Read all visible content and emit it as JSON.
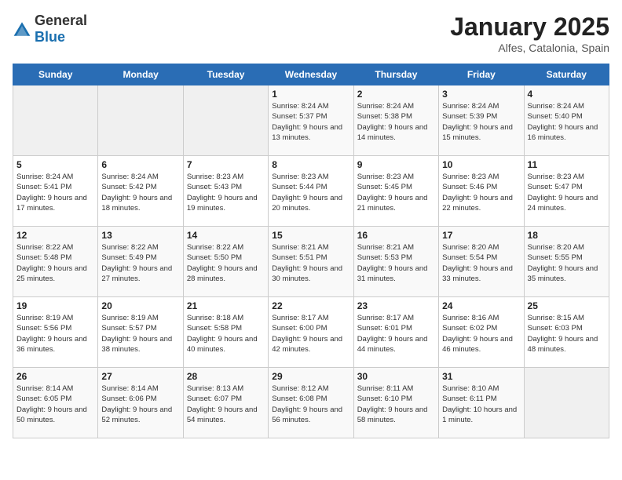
{
  "header": {
    "logo_general": "General",
    "logo_blue": "Blue",
    "title": "January 2025",
    "subtitle": "Alfes, Catalonia, Spain"
  },
  "days_of_week": [
    "Sunday",
    "Monday",
    "Tuesday",
    "Wednesday",
    "Thursday",
    "Friday",
    "Saturday"
  ],
  "weeks": [
    [
      {
        "day": null
      },
      {
        "day": null
      },
      {
        "day": null
      },
      {
        "day": "1",
        "sunrise": "Sunrise: 8:24 AM",
        "sunset": "Sunset: 5:37 PM",
        "daylight": "Daylight: 9 hours and 13 minutes."
      },
      {
        "day": "2",
        "sunrise": "Sunrise: 8:24 AM",
        "sunset": "Sunset: 5:38 PM",
        "daylight": "Daylight: 9 hours and 14 minutes."
      },
      {
        "day": "3",
        "sunrise": "Sunrise: 8:24 AM",
        "sunset": "Sunset: 5:39 PM",
        "daylight": "Daylight: 9 hours and 15 minutes."
      },
      {
        "day": "4",
        "sunrise": "Sunrise: 8:24 AM",
        "sunset": "Sunset: 5:40 PM",
        "daylight": "Daylight: 9 hours and 16 minutes."
      }
    ],
    [
      {
        "day": "5",
        "sunrise": "Sunrise: 8:24 AM",
        "sunset": "Sunset: 5:41 PM",
        "daylight": "Daylight: 9 hours and 17 minutes."
      },
      {
        "day": "6",
        "sunrise": "Sunrise: 8:24 AM",
        "sunset": "Sunset: 5:42 PM",
        "daylight": "Daylight: 9 hours and 18 minutes."
      },
      {
        "day": "7",
        "sunrise": "Sunrise: 8:23 AM",
        "sunset": "Sunset: 5:43 PM",
        "daylight": "Daylight: 9 hours and 19 minutes."
      },
      {
        "day": "8",
        "sunrise": "Sunrise: 8:23 AM",
        "sunset": "Sunset: 5:44 PM",
        "daylight": "Daylight: 9 hours and 20 minutes."
      },
      {
        "day": "9",
        "sunrise": "Sunrise: 8:23 AM",
        "sunset": "Sunset: 5:45 PM",
        "daylight": "Daylight: 9 hours and 21 minutes."
      },
      {
        "day": "10",
        "sunrise": "Sunrise: 8:23 AM",
        "sunset": "Sunset: 5:46 PM",
        "daylight": "Daylight: 9 hours and 22 minutes."
      },
      {
        "day": "11",
        "sunrise": "Sunrise: 8:23 AM",
        "sunset": "Sunset: 5:47 PM",
        "daylight": "Daylight: 9 hours and 24 minutes."
      }
    ],
    [
      {
        "day": "12",
        "sunrise": "Sunrise: 8:22 AM",
        "sunset": "Sunset: 5:48 PM",
        "daylight": "Daylight: 9 hours and 25 minutes."
      },
      {
        "day": "13",
        "sunrise": "Sunrise: 8:22 AM",
        "sunset": "Sunset: 5:49 PM",
        "daylight": "Daylight: 9 hours and 27 minutes."
      },
      {
        "day": "14",
        "sunrise": "Sunrise: 8:22 AM",
        "sunset": "Sunset: 5:50 PM",
        "daylight": "Daylight: 9 hours and 28 minutes."
      },
      {
        "day": "15",
        "sunrise": "Sunrise: 8:21 AM",
        "sunset": "Sunset: 5:51 PM",
        "daylight": "Daylight: 9 hours and 30 minutes."
      },
      {
        "day": "16",
        "sunrise": "Sunrise: 8:21 AM",
        "sunset": "Sunset: 5:53 PM",
        "daylight": "Daylight: 9 hours and 31 minutes."
      },
      {
        "day": "17",
        "sunrise": "Sunrise: 8:20 AM",
        "sunset": "Sunset: 5:54 PM",
        "daylight": "Daylight: 9 hours and 33 minutes."
      },
      {
        "day": "18",
        "sunrise": "Sunrise: 8:20 AM",
        "sunset": "Sunset: 5:55 PM",
        "daylight": "Daylight: 9 hours and 35 minutes."
      }
    ],
    [
      {
        "day": "19",
        "sunrise": "Sunrise: 8:19 AM",
        "sunset": "Sunset: 5:56 PM",
        "daylight": "Daylight: 9 hours and 36 minutes."
      },
      {
        "day": "20",
        "sunrise": "Sunrise: 8:19 AM",
        "sunset": "Sunset: 5:57 PM",
        "daylight": "Daylight: 9 hours and 38 minutes."
      },
      {
        "day": "21",
        "sunrise": "Sunrise: 8:18 AM",
        "sunset": "Sunset: 5:58 PM",
        "daylight": "Daylight: 9 hours and 40 minutes."
      },
      {
        "day": "22",
        "sunrise": "Sunrise: 8:17 AM",
        "sunset": "Sunset: 6:00 PM",
        "daylight": "Daylight: 9 hours and 42 minutes."
      },
      {
        "day": "23",
        "sunrise": "Sunrise: 8:17 AM",
        "sunset": "Sunset: 6:01 PM",
        "daylight": "Daylight: 9 hours and 44 minutes."
      },
      {
        "day": "24",
        "sunrise": "Sunrise: 8:16 AM",
        "sunset": "Sunset: 6:02 PM",
        "daylight": "Daylight: 9 hours and 46 minutes."
      },
      {
        "day": "25",
        "sunrise": "Sunrise: 8:15 AM",
        "sunset": "Sunset: 6:03 PM",
        "daylight": "Daylight: 9 hours and 48 minutes."
      }
    ],
    [
      {
        "day": "26",
        "sunrise": "Sunrise: 8:14 AM",
        "sunset": "Sunset: 6:05 PM",
        "daylight": "Daylight: 9 hours and 50 minutes."
      },
      {
        "day": "27",
        "sunrise": "Sunrise: 8:14 AM",
        "sunset": "Sunset: 6:06 PM",
        "daylight": "Daylight: 9 hours and 52 minutes."
      },
      {
        "day": "28",
        "sunrise": "Sunrise: 8:13 AM",
        "sunset": "Sunset: 6:07 PM",
        "daylight": "Daylight: 9 hours and 54 minutes."
      },
      {
        "day": "29",
        "sunrise": "Sunrise: 8:12 AM",
        "sunset": "Sunset: 6:08 PM",
        "daylight": "Daylight: 9 hours and 56 minutes."
      },
      {
        "day": "30",
        "sunrise": "Sunrise: 8:11 AM",
        "sunset": "Sunset: 6:10 PM",
        "daylight": "Daylight: 9 hours and 58 minutes."
      },
      {
        "day": "31",
        "sunrise": "Sunrise: 8:10 AM",
        "sunset": "Sunset: 6:11 PM",
        "daylight": "Daylight: 10 hours and 1 minute."
      },
      {
        "day": null
      }
    ]
  ]
}
